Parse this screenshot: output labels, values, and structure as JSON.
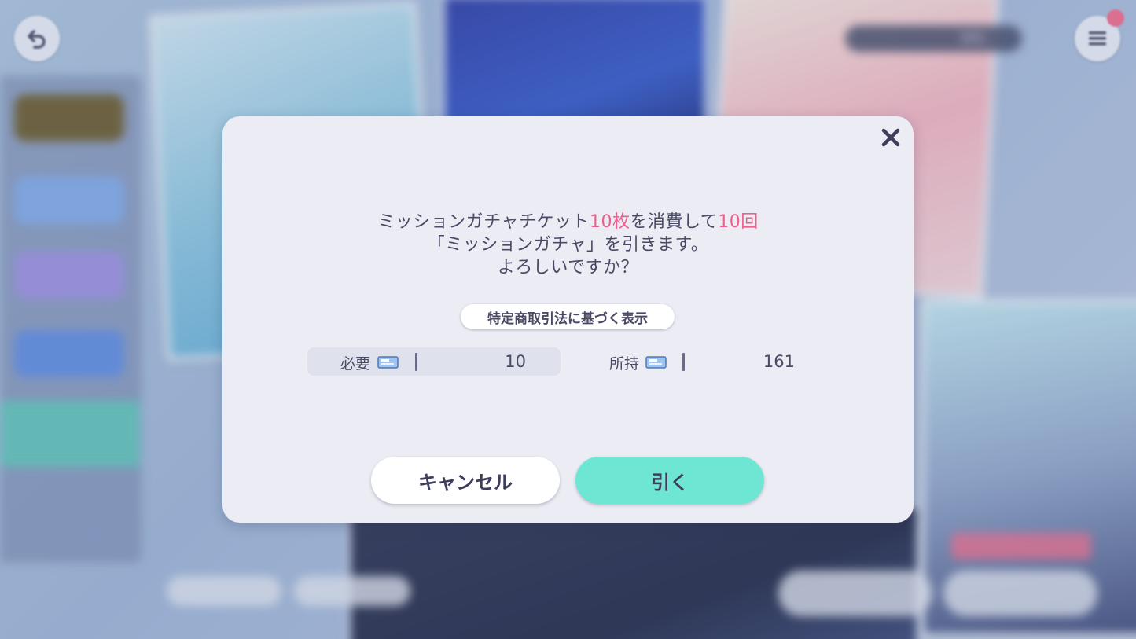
{
  "background": {
    "ticket_count_display": "161"
  },
  "dialog": {
    "message": {
      "line1_part1": "ミッションガチャチケット",
      "line1_highlight1": "10枚",
      "line1_part2": "を消費して",
      "line1_highlight2": "10回",
      "line2": "「ミッションガチャ」を引きます。",
      "line3": "よろしいですか？"
    },
    "legal_button_label": "特定商取引法に基づく表示",
    "required": {
      "label": "必要",
      "value": "10"
    },
    "owned": {
      "label": "所持",
      "value": "161"
    },
    "cancel_label": "キャンセル",
    "confirm_label": "引く"
  },
  "colors": {
    "highlight": "#ee5f8d",
    "confirm_button": "#6de6d4",
    "text": "#4a4a66"
  },
  "icons": [
    "back-arrow-icon",
    "menu-icon",
    "close-icon",
    "ticket-icon"
  ]
}
